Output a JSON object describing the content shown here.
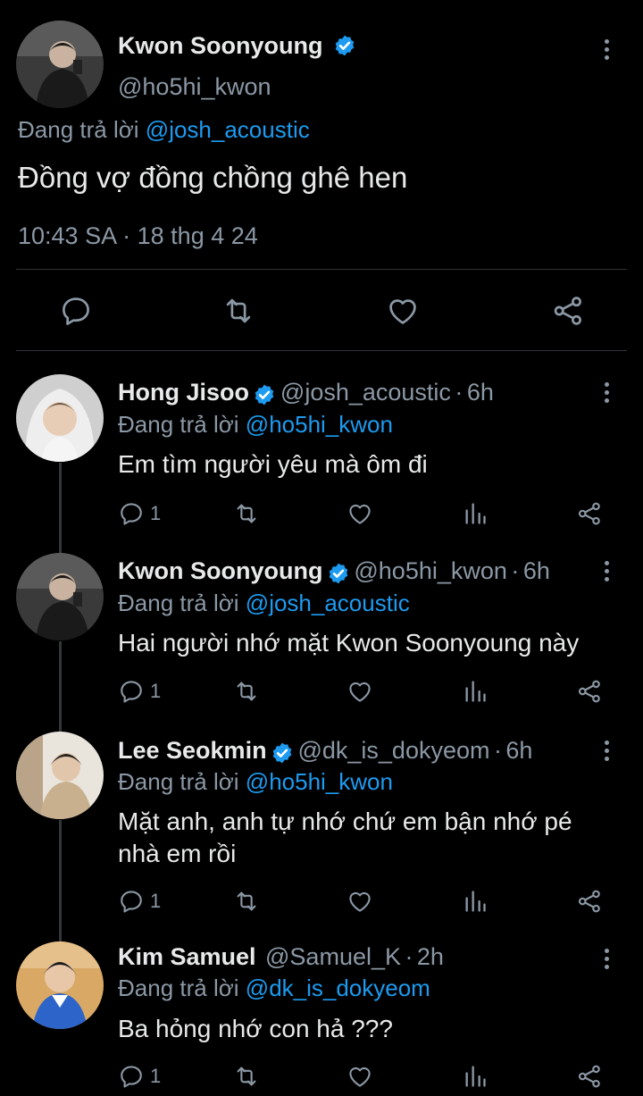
{
  "main_tweet": {
    "author_name": "Kwon Soonyoung",
    "handle": "@ho5hi_kwon",
    "replying_prefix": "Đang trả lời",
    "replying_to": "@josh_acoustic",
    "text": "Đồng vợ đồng chồng ghê hen",
    "time": "10:43 SA",
    "date": "18 thg 4 24"
  },
  "replies": [
    {
      "author_name": "Hong Jisoo",
      "handle": "@josh_acoustic",
      "age": "6h",
      "replying_prefix": "Đang trả lời",
      "replying_to": "@ho5hi_kwon",
      "text": "Em tìm người yêu mà ôm đi",
      "reply_count": "1"
    },
    {
      "author_name": "Kwon Soonyoung",
      "handle": "@ho5hi_kwon",
      "age": "6h",
      "replying_prefix": "Đang trả lời",
      "replying_to": "@josh_acoustic",
      "text": "Hai người nhớ mặt Kwon Soonyoung này",
      "reply_count": "1"
    },
    {
      "author_name": "Lee Seokmin",
      "handle": "@dk_is_dokyeom",
      "age": "6h",
      "replying_prefix": "Đang trả lời",
      "replying_to": "@ho5hi_kwon",
      "text_line1": "Mặt anh, anh tự nhớ chứ em bận nhớ pé",
      "text_line2": "nhà em rồi",
      "reply_count": "1"
    },
    {
      "author_name": "Kim Samuel",
      "handle": "@Samuel_K",
      "age": "2h",
      "replying_prefix": "Đang trả lời",
      "replying_to": "@dk_is_dokyeom",
      "text": "Ba hỏng nhớ con hả ???",
      "reply_count": "1"
    }
  ],
  "separator": "·",
  "colors": {
    "background": "#000000",
    "text": "#e7e9ea",
    "secondary": "#8b98a5",
    "accent": "#1d9bf0"
  }
}
